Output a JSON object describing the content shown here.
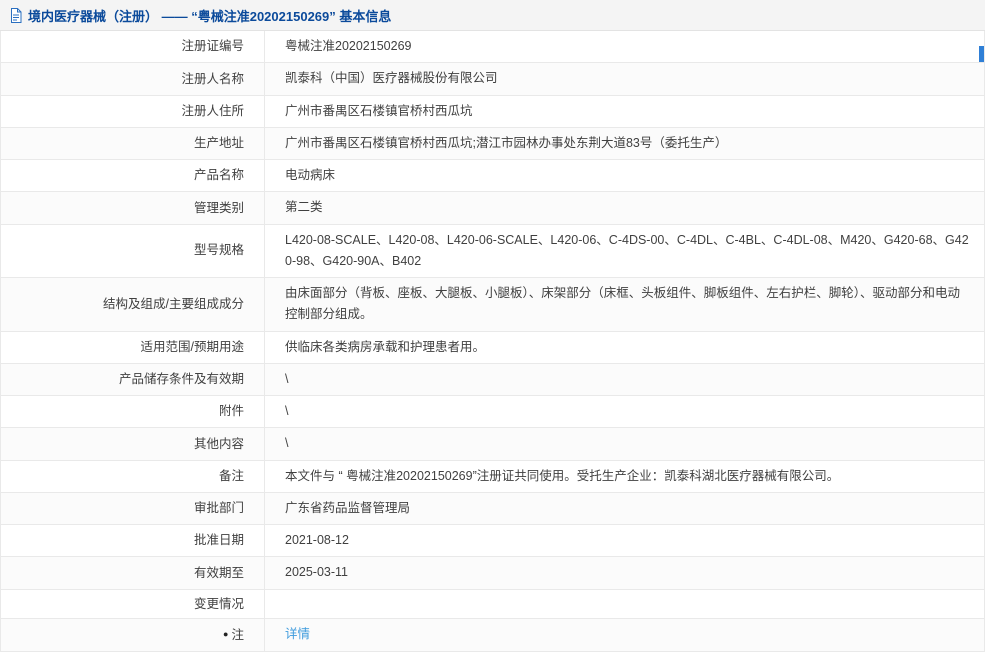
{
  "header": {
    "title": "境内医疗器械（注册） —— “粤械注准20202150269” 基本信息"
  },
  "colors": {
    "title_blue": "#0b4a9b",
    "link_blue": "#3e9bdd",
    "scrollbar_blue": "#2f7fd6",
    "border_gray": "#e9e9e9",
    "topbar_bg": "#f4f4f4"
  },
  "icons": {
    "document_icon": "document-outline",
    "note_bullet": "●"
  },
  "table": {
    "rows": [
      {
        "label": "注册证编号",
        "value": "粤械注准20202150269"
      },
      {
        "label": "注册人名称",
        "value": "凯泰科（中国）医疗器械股份有限公司"
      },
      {
        "label": "注册人住所",
        "value": "广州市番禺区石楼镇官桥村西瓜坑"
      },
      {
        "label": "生产地址",
        "value": "广州市番禺区石楼镇官桥村西瓜坑;潜江市园林办事处东荆大道83号（委托生产）"
      },
      {
        "label": "产品名称",
        "value": "电动病床"
      },
      {
        "label": "管理类别",
        "value": "第二类"
      },
      {
        "label": "型号规格",
        "value": "L420-08-SCALE、L420-08、L420-06-SCALE、L420-06、C-4DS-00、C-4DL、C-4BL、C-4DL-08、M420、G420-68、G420-98、G420-90A、B402"
      },
      {
        "label": "结构及组成/主要组成成分",
        "value": "由床面部分（背板、座板、大腿板、小腿板）、床架部分（床框、头板组件、脚板组件、左右护栏、脚轮）、驱动部分和电动控制部分组成。"
      },
      {
        "label": "适用范围/预期用途",
        "value": "供临床各类病房承载和护理患者用。"
      },
      {
        "label": "产品储存条件及有效期",
        "value": "\\"
      },
      {
        "label": "附件",
        "value": "\\"
      },
      {
        "label": "其他内容",
        "value": "\\"
      },
      {
        "label": "备注",
        "value": "本文件与 “ 粤械注准20202150269”注册证共同使用。受托生产企业：凯泰科湖北医疗器械有限公司。"
      },
      {
        "label": "审批部门",
        "value": "广东省药品监督管理局"
      },
      {
        "label": "批准日期",
        "value": "2021-08-12"
      },
      {
        "label": "有效期至",
        "value": "2025-03-11"
      },
      {
        "label": "变更情况",
        "value": ""
      }
    ]
  },
  "note_row": {
    "bullet": "●",
    "label": "注",
    "link_label": "详情"
  }
}
